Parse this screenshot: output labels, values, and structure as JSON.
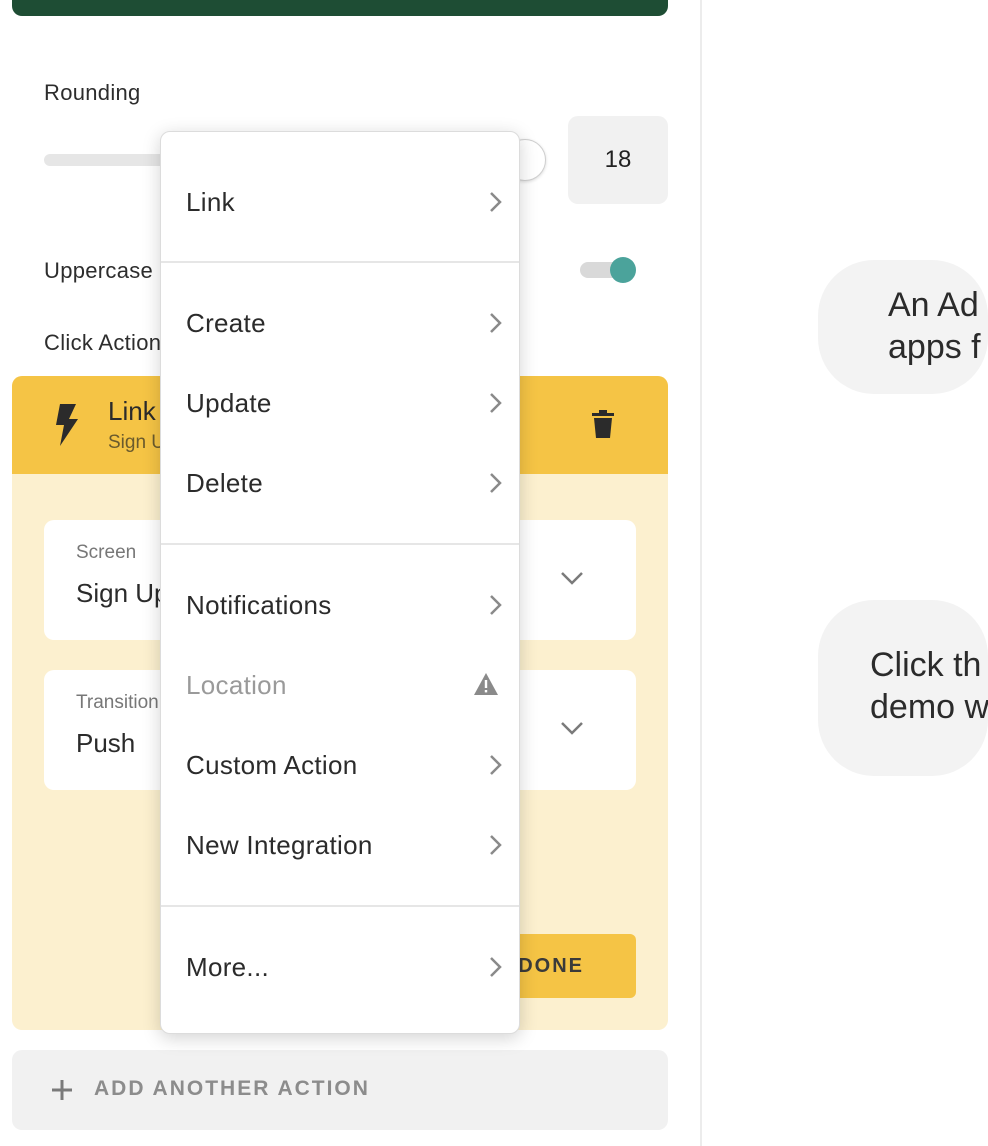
{
  "settings": {
    "rounding_label": "Rounding",
    "rounding_value": "18",
    "rounding_slider_fraction": 1.0,
    "uppercase_label": "Uppercase",
    "uppercase_on": true,
    "click_actions_label": "Click Actions"
  },
  "action": {
    "title": "Link",
    "subtitle": "Sign Up",
    "screen_label": "Screen",
    "screen_value": "Sign Up",
    "transition_label": "Transition",
    "transition_value": "Push",
    "done_label": "DONE"
  },
  "add_action_label": "ADD ANOTHER ACTION",
  "bubbles": {
    "first": [
      "An Ad",
      "apps f"
    ],
    "second": [
      "Click th",
      "demo w"
    ]
  },
  "menu": {
    "items": [
      {
        "label": "Link"
      },
      {
        "label": "Create"
      },
      {
        "label": "Update"
      },
      {
        "label": "Delete"
      },
      {
        "label": "Notifications"
      },
      {
        "label": "Location",
        "disabled": true,
        "icon": "warning-icon"
      },
      {
        "label": "Custom Action"
      },
      {
        "label": "New Integration"
      },
      {
        "label": "More..."
      }
    ]
  },
  "colors": {
    "header_dark_green": "#1e4d34",
    "accent_yellow": "#f5c445",
    "card_bg": "#fcf0cf",
    "toggle_teal": "#4ba39b"
  }
}
